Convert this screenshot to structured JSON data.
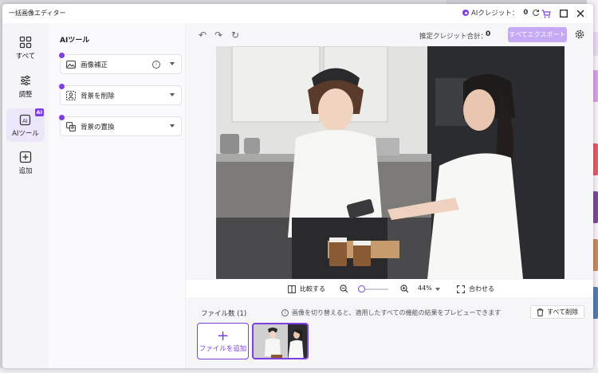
{
  "window": {
    "title": "一括画像エディター"
  },
  "credits": {
    "label": "AIクレジット：",
    "value": "0"
  },
  "rail": [
    {
      "label": "すべて"
    },
    {
      "label": "調整"
    },
    {
      "label": "AIツール",
      "badge": "AI"
    },
    {
      "label": "追加"
    }
  ],
  "tools": {
    "title": "AIツール",
    "items": [
      {
        "label": "画像補正"
      },
      {
        "label": "背景を削除"
      },
      {
        "label": "背景の置換"
      }
    ]
  },
  "toolbar": {
    "estimate_label": "推定クレジット合計：",
    "estimate_value": "0",
    "export_label": "すべてエクスポート"
  },
  "controls": {
    "compare_label": "比較する",
    "zoom_value": "44%",
    "zoom_fraction": 0.44,
    "fit_label": "合わせる"
  },
  "files": {
    "count_label": "ファイル数 (1)",
    "hint": "画像を切り替えると、適用したすべての機能の結果をプレビューできます",
    "delete_all_label": "すべて削除",
    "add_label": "ファイルを追加"
  },
  "colors": {
    "accent": "#7b3fe4",
    "export_button": "#c6a9f4"
  }
}
